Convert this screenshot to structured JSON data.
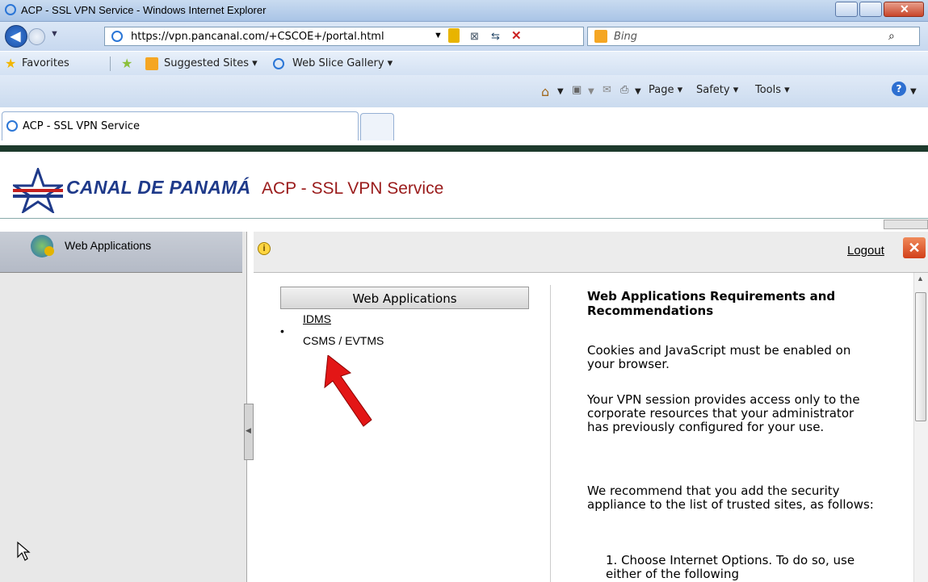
{
  "window": {
    "title": "ACP - SSL VPN Service - Windows Internet Explorer"
  },
  "address_bar": {
    "url": "https://vpn.pancanal.com/+CSCOE+/portal.html"
  },
  "search": {
    "placeholder": "Bing"
  },
  "favorites_bar": {
    "favorites_label": "Favorites",
    "items": [
      "Suggested Sites ▾",
      "Web Slice Gallery ▾"
    ]
  },
  "tabs": [
    {
      "label": "ACP - SSL VPN Service"
    }
  ],
  "command_bar": {
    "page": "Page ▾",
    "safety": "Safety ▾",
    "tools": "Tools ▾"
  },
  "header": {
    "brand": "CANAL DE PANAMÁ",
    "service_title": "ACP - SSL VPN Service"
  },
  "sidebar": {
    "items": [
      {
        "label": "Web Applications"
      }
    ]
  },
  "toolbar": {
    "logout_label": "Logout"
  },
  "web_apps": {
    "heading": "Web Applications",
    "links": [
      "IDMS",
      "CSMS / EVTMS"
    ]
  },
  "requirements": {
    "title": "Web Applications Requirements and Recommendations",
    "p1": "Cookies and JavaScript must be enabled on your browser.",
    "p2": "Your VPN session provides access only to the corporate resources that your administrator has previously configured for your use.",
    "p3": "We recommend that you add the security appliance to the list of trusted sites, as follows:",
    "step1": "1. Choose Internet Options. To do so, use either of the following"
  },
  "colors": {
    "brand_blue": "#1f3a8a",
    "service_red": "#9a1b1b",
    "accent_green": "#1d3a2c"
  }
}
